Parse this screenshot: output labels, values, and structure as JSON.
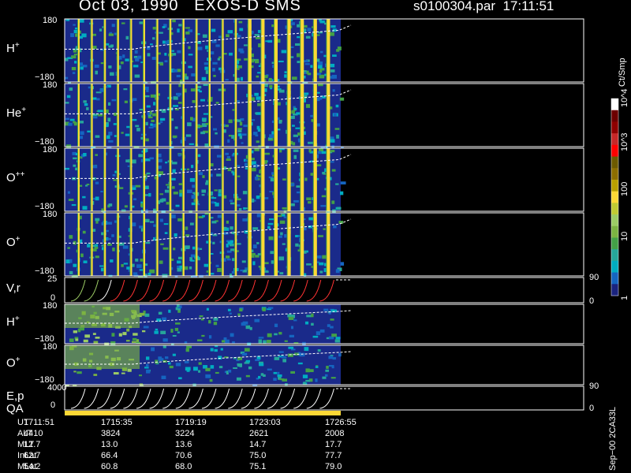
{
  "title": {
    "date": "Oct 03, 1990",
    "instrument": "EXOS-D SMS",
    "file": "s0100304.par",
    "time": "17:11:51"
  },
  "colorbar": {
    "unit": "Ct/Smp",
    "ticks": [
      "1",
      "10",
      "100",
      "10^3",
      "10^4"
    ],
    "colors": [
      "#1a237e",
      "#1565c0",
      "#00acc1",
      "#26a69a",
      "#43a047",
      "#7cb342",
      "#9ccc65",
      "#c0ca33",
      "#fdd835",
      "#b8a000",
      "#8d6e00",
      "#6d5a00",
      "#ff0000",
      "#c62828",
      "#8e0000",
      "#6d0000",
      "#ffffff"
    ]
  },
  "side_note": "Sep−00 2CA33L",
  "chart_data": {
    "type": "heatmap",
    "panels": [
      {
        "label": "H",
        "sup": "+",
        "ymin": "−180",
        "ymax": "180",
        "kind": "spec"
      },
      {
        "label": "He",
        "sup": "+",
        "ymin": "−180",
        "ymax": "180",
        "kind": "spec"
      },
      {
        "label": "O",
        "sup": "++",
        "ymin": "−180",
        "ymax": "180",
        "kind": "spec"
      },
      {
        "label": "O",
        "sup": "+",
        "ymin": "−180",
        "ymax": "180",
        "kind": "spec"
      },
      {
        "label": "V,r",
        "sup": "",
        "ymin": "0",
        "ymax": "25",
        "kind": "line",
        "right_top": "90",
        "right_bot": "0"
      },
      {
        "label": "H",
        "sup": "+",
        "ymin": "−180",
        "ymax": "180",
        "kind": "spec2"
      },
      {
        "label": "O",
        "sup": "+",
        "ymin": "−180",
        "ymax": "180",
        "kind": "spec2"
      },
      {
        "label": "E,p",
        "sup": "",
        "ymin": "0",
        "ymax": "4000",
        "kind": "line",
        "right_top": "90",
        "right_bot": "0"
      }
    ],
    "qa_label": "QA",
    "footer": {
      "rows": [
        {
          "name": "UT",
          "values": [
            "1711:51",
            "1715:35",
            "1719:19",
            "1723:03",
            "1726:55"
          ]
        },
        {
          "name": "ALT",
          "values": [
            "4410",
            "3824",
            "3224",
            "2621",
            "2008"
          ]
        },
        {
          "name": "MLT",
          "values": [
            "12.7",
            "13.0",
            "13.6",
            "14.7",
            "17.7"
          ]
        },
        {
          "name": "InLat",
          "values": [
            "62.7",
            "66.4",
            "70.6",
            "75.0",
            "77.7"
          ]
        },
        {
          "name": "MLat",
          "values": [
            "54.2",
            "60.8",
            "68.0",
            "75.1",
            "79.0"
          ]
        }
      ]
    }
  }
}
